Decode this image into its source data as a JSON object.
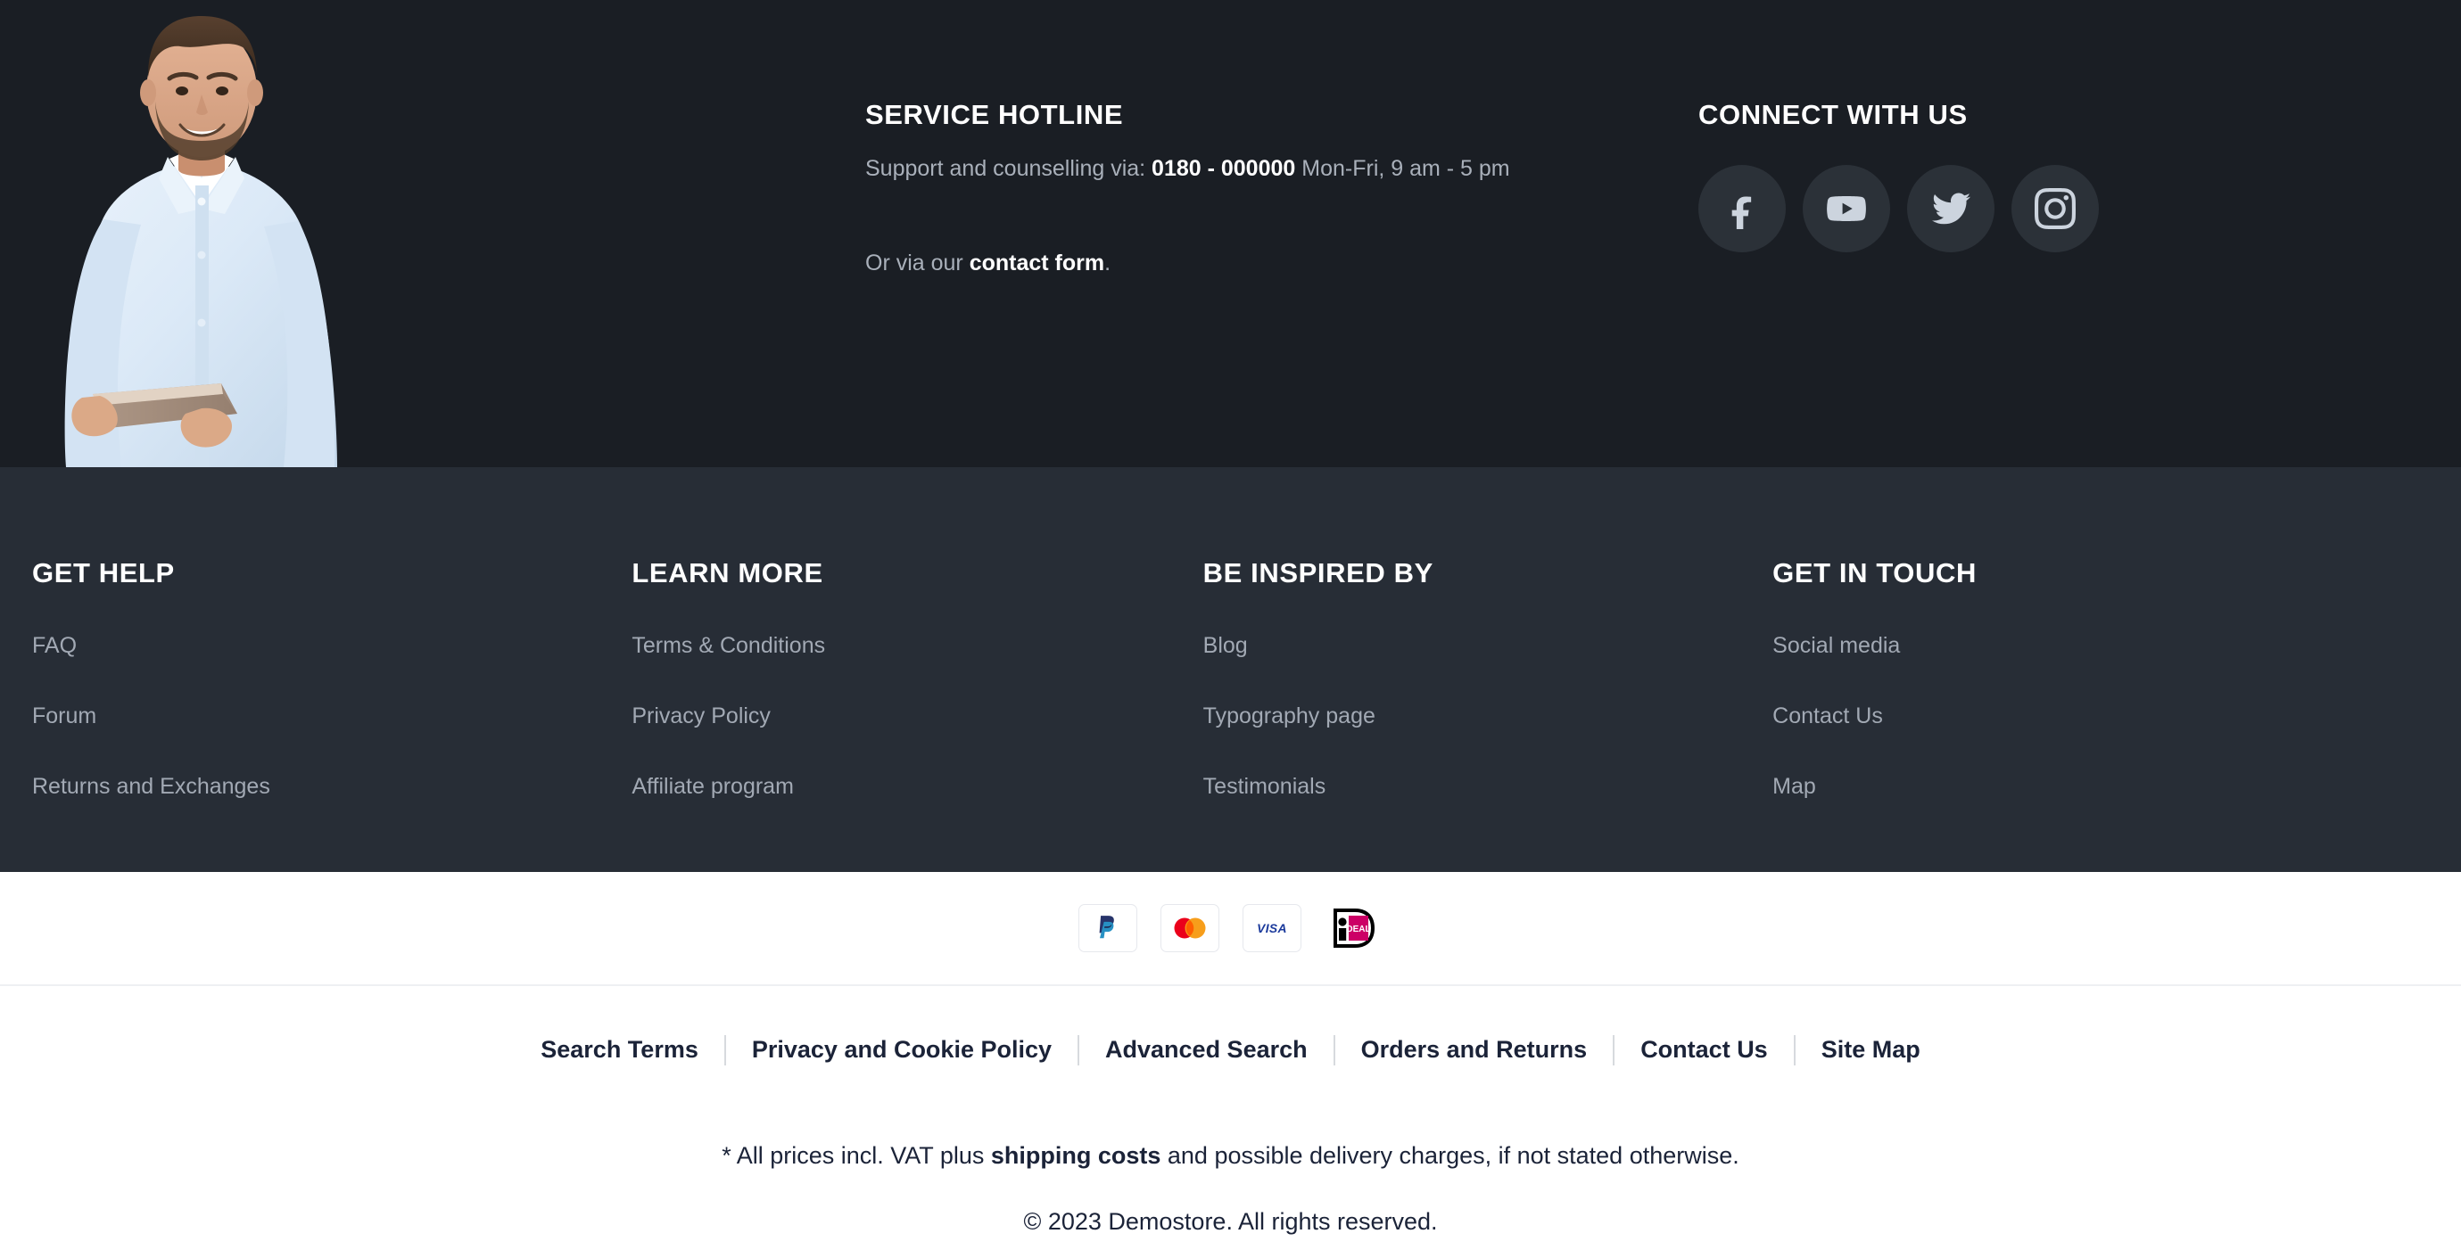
{
  "colors": {
    "top_band_bg": "#1a1e24",
    "links_band_bg": "#272d36",
    "heading_text": "#ffffff",
    "muted_text": "#a2a9b4",
    "social_circle": "#2b3138",
    "social_icon": "#ccd4de",
    "dark_navy_text": "#1b2338",
    "divider": "#eef0f3"
  },
  "hotline": {
    "title": "SERVICE HOTLINE",
    "line1_pre": "Support and counselling via: ",
    "line1_phone": "0180 - 000000",
    "line1_post": " Mon-Fri, 9 am - 5 pm",
    "line2_pre": "Or via our ",
    "line2_link": "contact form",
    "line2_post": "."
  },
  "connect": {
    "title": "CONNECT WITH US",
    "socials": [
      {
        "name": "facebook",
        "label": "Facebook"
      },
      {
        "name": "youtube",
        "label": "YouTube"
      },
      {
        "name": "twitter",
        "label": "Twitter"
      },
      {
        "name": "instagram",
        "label": "Instagram"
      }
    ]
  },
  "link_columns": [
    {
      "title": "GET HELP",
      "links": [
        "FAQ",
        "Forum",
        "Returns and Exchanges"
      ]
    },
    {
      "title": "LEARN MORE",
      "links": [
        "Terms & Conditions",
        "Privacy Policy",
        "Affiliate program"
      ]
    },
    {
      "title": "BE INSPIRED BY",
      "links": [
        "Blog",
        "Typography page",
        "Testimonials"
      ]
    },
    {
      "title": "GET IN TOUCH",
      "links": [
        "Social media",
        "Contact Us",
        "Map"
      ]
    }
  ],
  "payments": [
    {
      "name": "paypal",
      "label": "PayPal"
    },
    {
      "name": "mastercard",
      "label": "Mastercard"
    },
    {
      "name": "visa",
      "label": "VISA"
    },
    {
      "name": "ideal",
      "label": "iDEAL"
    }
  ],
  "bottom_links": [
    "Search Terms",
    "Privacy and Cookie Policy",
    "Advanced Search",
    "Orders and Returns",
    "Contact Us",
    "Site Map"
  ],
  "vat_note": {
    "pre": "* All prices incl. VAT plus ",
    "link": "shipping costs",
    "post": " and possible delivery charges, if not stated otherwise."
  },
  "copyright": "© 2023 Demostore. All rights reserved.",
  "hero_image": {
    "alt": "smiling man in light blue shirt holding a tablet"
  }
}
